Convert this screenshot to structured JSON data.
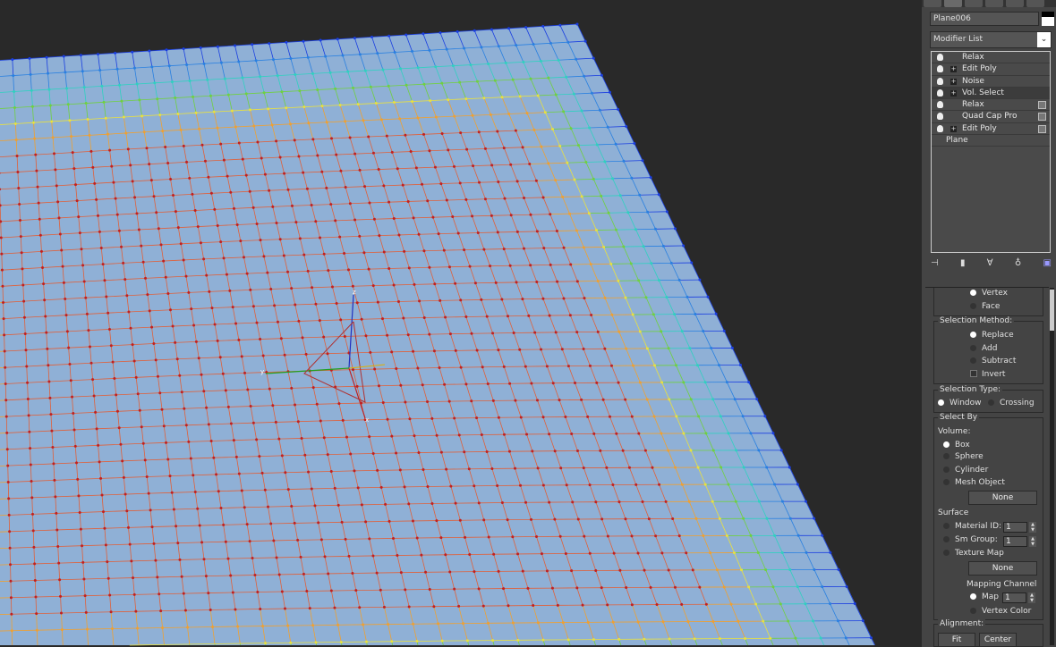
{
  "viewport": {
    "gizmo_axes": {
      "x": "x",
      "y": "y",
      "z": "z"
    }
  },
  "panel": {
    "object_name": "Plane006",
    "modifier_list": "Modifier List",
    "stack": [
      {
        "label": "Relax",
        "expand": false,
        "checkbox": false,
        "selected": false
      },
      {
        "label": "Edit Poly",
        "expand": true,
        "checkbox": false,
        "selected": false
      },
      {
        "label": "Noise",
        "expand": true,
        "checkbox": false,
        "selected": false
      },
      {
        "label": "Vol. Select",
        "expand": true,
        "checkbox": false,
        "selected": true
      },
      {
        "label": "Relax",
        "expand": false,
        "checkbox": true,
        "selected": false
      },
      {
        "label": "Quad Cap Pro",
        "expand": false,
        "checkbox": true,
        "selected": false
      },
      {
        "label": "Edit Poly",
        "expand": true,
        "checkbox": true,
        "selected": false
      }
    ],
    "base": "Plane",
    "stack_level": {
      "vertex": "Vertex",
      "face": "Face"
    },
    "selection_method": {
      "title": "Selection Method:",
      "replace": "Replace",
      "add": "Add",
      "subtract": "Subtract",
      "invert": "Invert"
    },
    "selection_type": {
      "title": "Selection Type:",
      "window": "Window",
      "crossing": "Crossing"
    },
    "select_by": {
      "title": "Select By",
      "volume": "Volume:",
      "box": "Box",
      "sphere": "Sphere",
      "cylinder": "Cylinder",
      "mesh_object": "Mesh Object",
      "none1": "None",
      "surface": "Surface",
      "material_id": "Material ID:",
      "material_id_value": "1",
      "sm_group": "Sm Group:",
      "sm_group_value": "1",
      "texture_map": "Texture Map",
      "none2": "None",
      "mapping_channel": "Mapping Channel",
      "map": "Map",
      "map_value": "1",
      "vertex_color": "Vertex Color"
    },
    "alignment": {
      "title": "Alignment:",
      "fit": "Fit",
      "center": "Center"
    }
  }
}
